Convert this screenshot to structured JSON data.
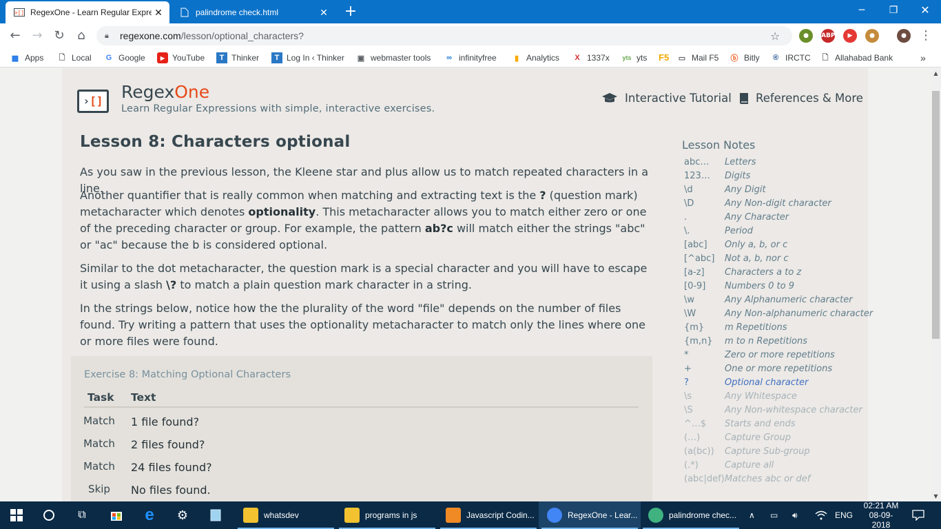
{
  "browser": {
    "tabs": [
      {
        "title": "RegexOne - Learn Regular Expres",
        "active": true
      },
      {
        "title": "palindrome check.html",
        "active": false
      }
    ],
    "address": {
      "host": "regexone.com",
      "path": "/lesson/optional_characters?"
    },
    "bookmarks": [
      "Apps",
      "Local",
      "Google",
      "YouTube",
      "Thinker",
      "Log In ‹ Thinker",
      "webmaster tools",
      "infinityfree",
      "Analytics",
      "1337x",
      "yts",
      "F5",
      "Mail F5",
      "Bitly",
      "IRCTC",
      "Allahabad Bank"
    ],
    "overflow": "»",
    "colors": {
      "tabstrip": "#0b72c9",
      "accent": "#e64a19"
    }
  },
  "site": {
    "name_main": "Regex",
    "name_accent": "One",
    "tagline": "Learn Regular Expressions with simple, interactive exercises.",
    "nav": [
      "Interactive Tutorial",
      "References & More"
    ]
  },
  "lesson": {
    "title": "Lesson 8: Characters optional",
    "p1": "As you saw in the previous lesson, the Kleene star and plus allow us to match repeated characters in a line.",
    "p2": {
      "a": "Another quantifier that is really common when matching and extracting text is the ",
      "q": "?",
      "b": " (question mark) metacharacter which denotes ",
      "opt": "optionality",
      "c": ". This metacharacter allows you to match either zero or one of the preceding character or group. For example, the pattern ",
      "pat": "ab?c",
      "d": " will match either the strings \"abc\" or \"ac\" because the b is considered optional."
    },
    "p3": {
      "a": "Similar to the dot metacharacter, the question mark is a special character and you will have to escape it using a slash ",
      "esc": "\\?",
      "b": " to match a plain question mark character in a string."
    },
    "p4": "In the strings below, notice how the the plurality of the word \"file\" depends on the number of files found. Try writing a pattern that uses the optionality metacharacter to match only the lines where one or more files were found."
  },
  "exercise": {
    "title": "Exercise 8: Matching Optional Characters",
    "headers": [
      "Task",
      "Text"
    ],
    "rows": [
      {
        "task": "Match",
        "text": "1 file found?"
      },
      {
        "task": "Match",
        "text": "2 files found?"
      },
      {
        "task": "Match",
        "text": "24 files found?"
      },
      {
        "task": "Skip",
        "text": "No files found."
      }
    ]
  },
  "notes": {
    "title": "Lesson Notes",
    "items": [
      {
        "sym": "abc…",
        "desc": "Letters",
        "state": "learned"
      },
      {
        "sym": "123…",
        "desc": "Digits",
        "state": "learned"
      },
      {
        "sym": "\\d",
        "desc": "Any Digit",
        "state": "learned"
      },
      {
        "sym": "\\D",
        "desc": "Any Non-digit character",
        "state": "learned"
      },
      {
        "sym": ".",
        "desc": "Any Character",
        "state": "learned"
      },
      {
        "sym": "\\.",
        "desc": "Period",
        "state": "learned"
      },
      {
        "sym": "[abc]",
        "desc": "Only a, b, or c",
        "state": "learned"
      },
      {
        "sym": "[^abc]",
        "desc": "Not a, b, nor c",
        "state": "learned"
      },
      {
        "sym": "[a-z]",
        "desc": "Characters a to z",
        "state": "learned"
      },
      {
        "sym": "[0-9]",
        "desc": "Numbers 0 to 9",
        "state": "learned"
      },
      {
        "sym": "\\w",
        "desc": "Any Alphanumeric character",
        "state": "learned"
      },
      {
        "sym": "\\W",
        "desc": "Any Non-alphanumeric character",
        "state": "learned"
      },
      {
        "sym": "{m}",
        "desc": "m Repetitions",
        "state": "learned"
      },
      {
        "sym": "{m,n}",
        "desc": "m to n Repetitions",
        "state": "learned"
      },
      {
        "sym": "*",
        "desc": "Zero or more repetitions",
        "state": "learned"
      },
      {
        "sym": "+",
        "desc": "One or more repetitions",
        "state": "learned"
      },
      {
        "sym": "?",
        "desc": "Optional character",
        "state": "current"
      },
      {
        "sym": "\\s",
        "desc": "Any Whitespace",
        "state": "future"
      },
      {
        "sym": "\\S",
        "desc": "Any Non-whitespace character",
        "state": "future"
      },
      {
        "sym": "^…$",
        "desc": "Starts and ends",
        "state": "future"
      },
      {
        "sym": "(…)",
        "desc": "Capture Group",
        "state": "future"
      },
      {
        "sym": "(a(bc))",
        "desc": "Capture Sub-group",
        "state": "future"
      },
      {
        "sym": "(.*)",
        "desc": "Capture all",
        "state": "future"
      },
      {
        "sym": "(abc|def)",
        "desc": "Matches abc or def",
        "state": "future"
      }
    ],
    "colors": {
      "learned": "#607d8b",
      "current": "#3f6fbf",
      "future": "#a7b2b8"
    }
  },
  "taskbar": {
    "apps": [
      {
        "label": "whatsdev",
        "color": "#f2c230"
      },
      {
        "label": "programs in js",
        "color": "#f2c230"
      },
      {
        "label": "Javascript Codin...",
        "color": "#f08a24"
      },
      {
        "label": "RegexOne - Lear...",
        "color": "#4285f4"
      },
      {
        "label": "palindrome chec...",
        "color": "#3fb27f"
      }
    ],
    "language": "ENG",
    "time": "02:21 AM",
    "date": "08-09-2018"
  }
}
